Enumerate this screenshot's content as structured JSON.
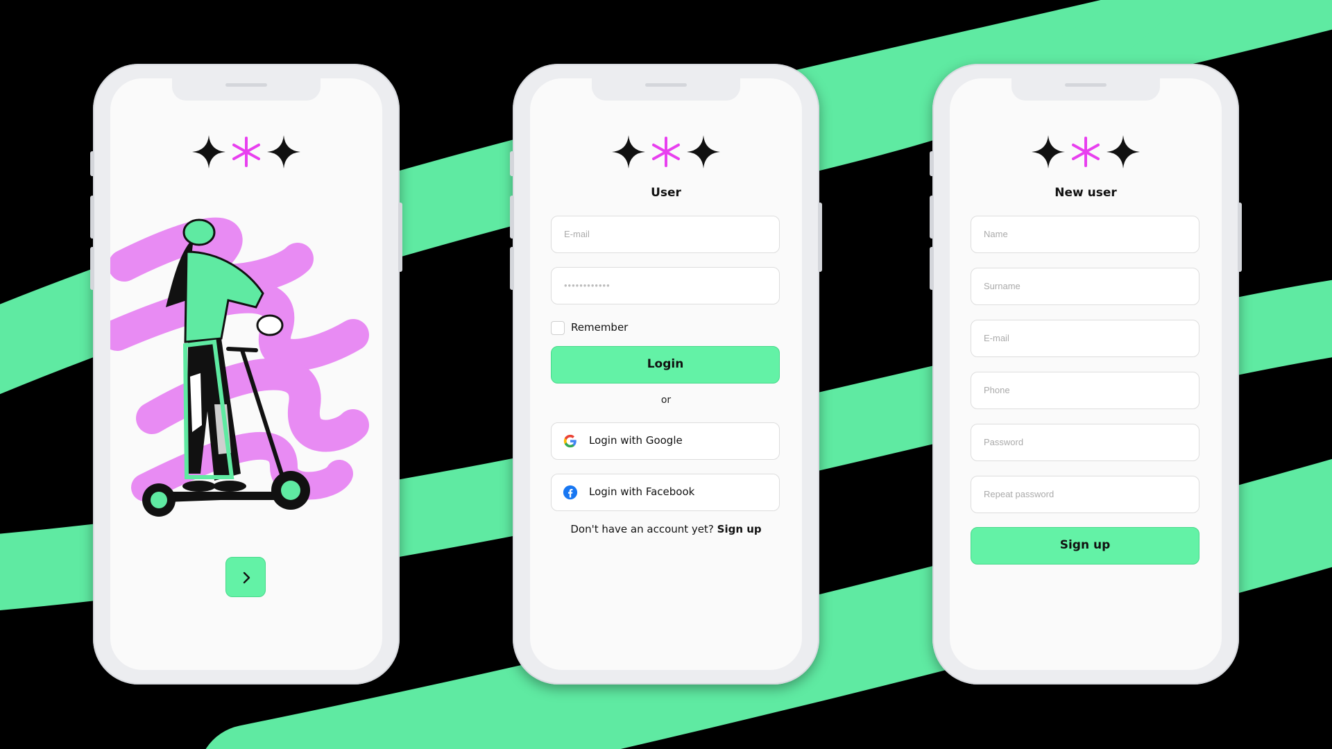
{
  "colors": {
    "accent": "#63F2A6",
    "magenta": "#E83FEF",
    "background": "#000000",
    "screen": "#FAFAFA"
  },
  "onboarding": {
    "logo_icon": "three-sparkles-logo",
    "illustration": "woman-on-scooter",
    "next_icon": "chevron-right-icon"
  },
  "login": {
    "title": "User",
    "email_placeholder": "E-mail",
    "password_value": "••••••••••••",
    "remember_label": "Remember",
    "login_label": "Login",
    "or_label": "or",
    "google_label": "Login with Google",
    "facebook_label": "Login with Facebook",
    "no_account_text": "Don't have an account yet?",
    "signup_link": "Sign up"
  },
  "signup": {
    "title": "New user",
    "fields": [
      "Name",
      "Surname",
      "E-mail",
      "Phone",
      "Password",
      "Repeat password"
    ],
    "signup_label": "Sign up"
  }
}
